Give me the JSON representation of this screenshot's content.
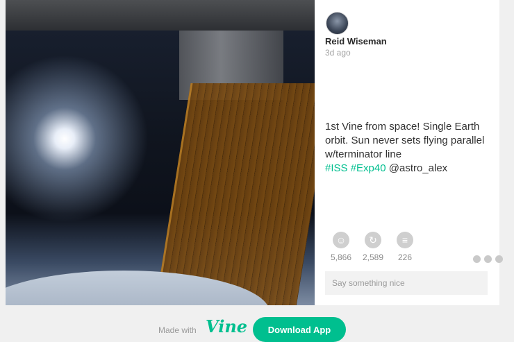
{
  "post": {
    "author": "Reid Wiseman",
    "time": "3d ago",
    "caption_text": "1st Vine from space! Single Earth orbit. Sun never sets flying parallel w/terminator line",
    "hashtags": [
      "#ISS",
      "#Exp40"
    ],
    "mention": "@astro_alex",
    "stats": [
      {
        "icon": "smile-icon",
        "value": "5,866"
      },
      {
        "icon": "revine-icon",
        "value": "2,589"
      },
      {
        "icon": "comment-icon",
        "value": "226"
      }
    ],
    "comment_placeholder": "Say something nice"
  },
  "footer": {
    "made_with": "Made with",
    "logo": "Vine",
    "download_label": "Download App"
  },
  "colors": {
    "accent": "#00bf8f",
    "background": "#f0f0f0"
  }
}
